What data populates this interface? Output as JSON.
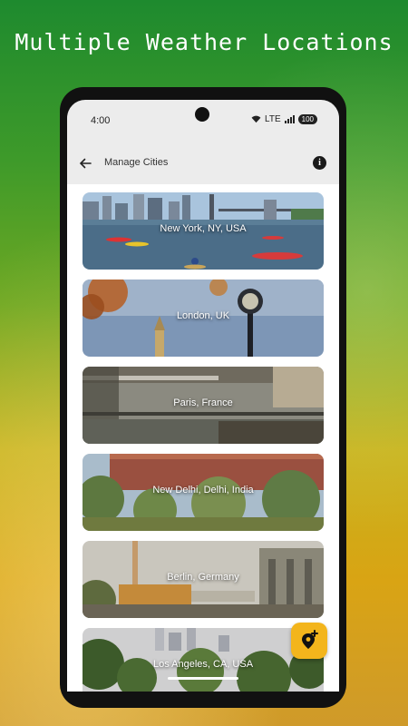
{
  "promo": {
    "headline": "Multiple Weather Locations"
  },
  "status_bar": {
    "time": "4:00",
    "network": "LTE",
    "battery": "100"
  },
  "app_bar": {
    "title": "Manage Cities"
  },
  "cities": [
    {
      "name": "New York, NY, USA"
    },
    {
      "name": "London, UK"
    },
    {
      "name": "Paris, France"
    },
    {
      "name": "New Delhi, Delhi, India"
    },
    {
      "name": "Berlin, Germany"
    },
    {
      "name": "Los Angeles, CA, USA"
    }
  ],
  "icons": {
    "back": "arrow-left-icon",
    "info": "info-icon",
    "add_location": "add-location-icon",
    "wifi": "wifi-icon",
    "signal": "signal-icon",
    "battery": "battery-icon"
  },
  "colors": {
    "accent": "#f3b51c",
    "screen_bg": "#ececec"
  }
}
